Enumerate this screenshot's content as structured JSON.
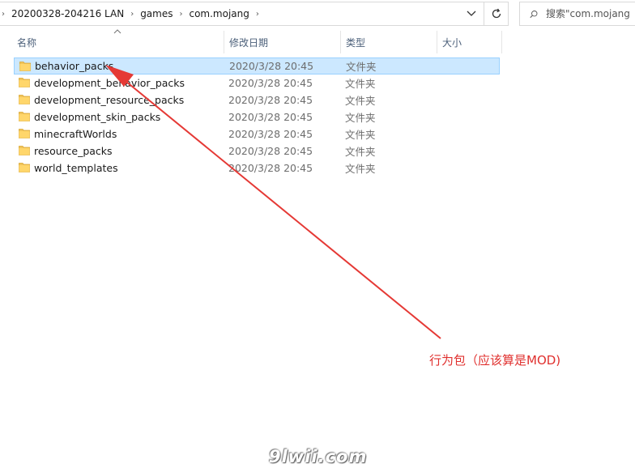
{
  "address_bar": {
    "breadcrumbs": [
      "20200328-204216 LAN",
      "games",
      "com.mojang"
    ]
  },
  "search": {
    "placeholder": "搜索\"com.mojang"
  },
  "columns": {
    "name": "名称",
    "date": "修改日期",
    "type": "类型",
    "size": "大小"
  },
  "files": [
    {
      "name": "behavior_packs",
      "date": "2020/3/28 20:45",
      "type": "文件夹",
      "selected": true
    },
    {
      "name": "development_behavior_packs",
      "date": "2020/3/28 20:45",
      "type": "文件夹"
    },
    {
      "name": "development_resource_packs",
      "date": "2020/3/28 20:45",
      "type": "文件夹"
    },
    {
      "name": "development_skin_packs",
      "date": "2020/3/28 20:45",
      "type": "文件夹"
    },
    {
      "name": "minecraftWorlds",
      "date": "2020/3/28 20:45",
      "type": "文件夹"
    },
    {
      "name": "resource_packs",
      "date": "2020/3/28 20:45",
      "type": "文件夹"
    },
    {
      "name": "world_templates",
      "date": "2020/3/28 20:45",
      "type": "文件夹"
    }
  ],
  "annotation": {
    "text": "行为包（应该算是MOD)",
    "color": "#e0302e"
  },
  "watermark": "9lwii.com",
  "icons": [
    "chevron-right-icon",
    "chevron-down-icon",
    "refresh-icon",
    "search-icon",
    "sort-up-icon",
    "folder-icon"
  ]
}
